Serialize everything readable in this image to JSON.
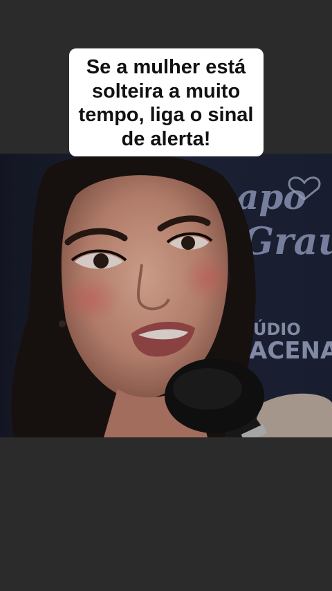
{
  "caption": {
    "lines": [
      "Se a mulher está",
      "solteira a muito",
      "tempo, liga o sinal",
      "de alerta!"
    ]
  },
  "background": {
    "logo_line1": "apo",
    "logo_line2": "Grau",
    "studio_line1": "ÚDIO",
    "studio_line2": "ACENA"
  },
  "colors": {
    "page_bg": "#2b2b2b",
    "caption_bg": "#ffffff",
    "caption_text": "#111111",
    "backdrop": "#1f2333"
  }
}
